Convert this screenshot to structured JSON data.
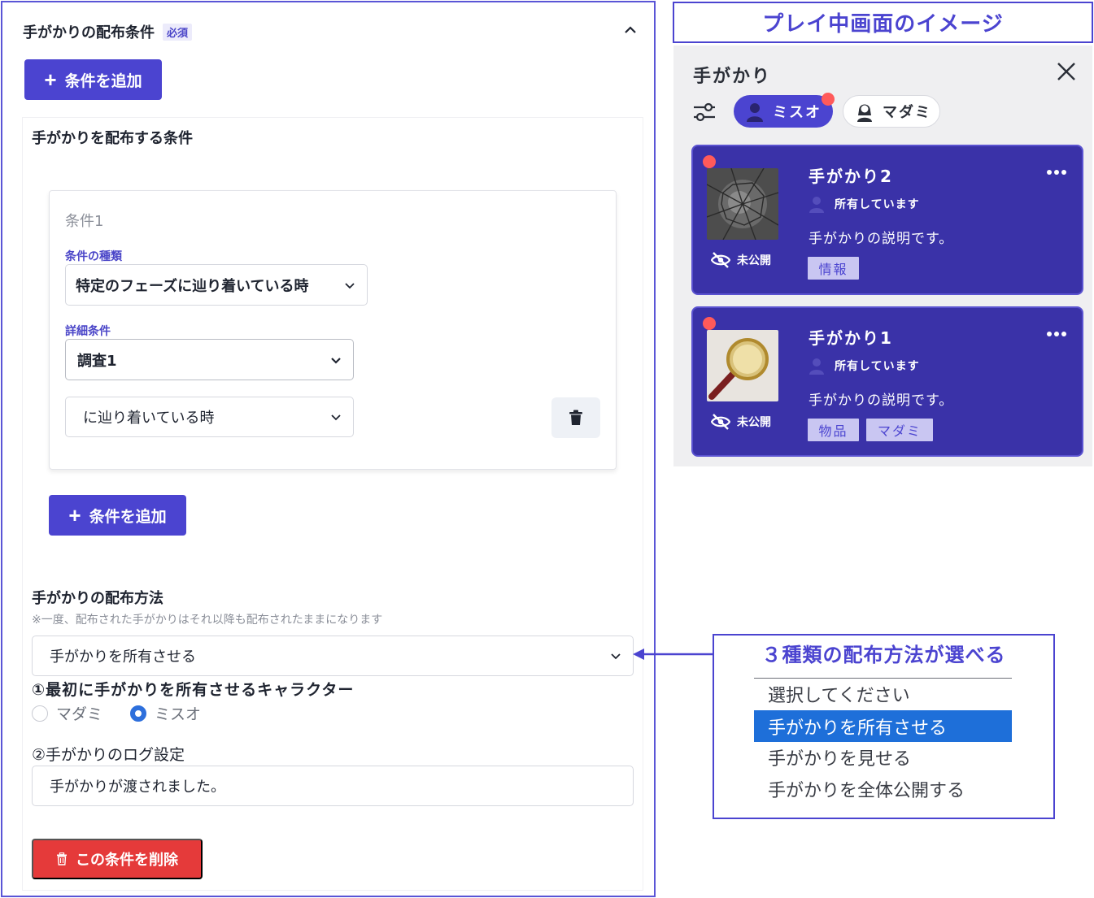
{
  "settings": {
    "section_title": "手がかりの配布条件",
    "required_badge": "必須",
    "add_condition_label": "条件を追加",
    "distribute_condition_heading": "手がかりを配布する条件",
    "condition": {
      "title": "条件1",
      "type_label": "条件の種類",
      "type_value": "特定のフェーズに辿り着いている時",
      "detail_label": "詳細条件",
      "detail_value": "調査1",
      "timing_value": "に辿り着いている時"
    },
    "inner_add_condition_label": "条件を追加",
    "method_heading": "手がかりの配布方法",
    "method_note": "※一度、配布された手がかりはそれ以降も配布されたままになります",
    "method_value": "手がかりを所有させる",
    "first_owner_label": "①最初に手がかりを所有させるキャラクター",
    "characters": [
      {
        "name": "マダミ",
        "checked": false
      },
      {
        "name": "ミスオ",
        "checked": true
      }
    ],
    "log_label": "②手がかりのログ設定",
    "log_value": "手がかりが渡されました。",
    "delete_label": "この条件を削除"
  },
  "preview": {
    "image_title": "プレイ中画面のイメージ",
    "panel_title": "手がかり",
    "tabs": [
      {
        "label": "ミスオ",
        "active": true,
        "has_notification": true
      },
      {
        "label": "マダミ",
        "active": false,
        "has_notification": false
      }
    ],
    "clues": [
      {
        "title": "手がかり2",
        "owner_status": "所有しています",
        "description": "手がかりの説明です。",
        "visibility": "未公開",
        "tags": [
          "情報"
        ],
        "thumbnail": "shattered-glass",
        "is_new": true
      },
      {
        "title": "手がかり1",
        "owner_status": "所有しています",
        "description": "手がかりの説明です。",
        "visibility": "未公開",
        "tags": [
          "物品",
          "マダミ"
        ],
        "thumbnail": "magnifying-glass",
        "is_new": true
      }
    ]
  },
  "callout": {
    "title": "３種類の配布方法が選べる",
    "options": [
      {
        "label": "選択してください",
        "selected": false
      },
      {
        "label": "手がかりを所有させる",
        "selected": true
      },
      {
        "label": "手がかりを見せる",
        "selected": false
      },
      {
        "label": "手がかりを全体公開する",
        "selected": false
      }
    ]
  },
  "colors": {
    "primary": "#4b44d0",
    "card": "#3a32a8",
    "danger": "#e53a3a",
    "notification": "#ff5a5a",
    "selected_option": "#1e6fd9"
  }
}
